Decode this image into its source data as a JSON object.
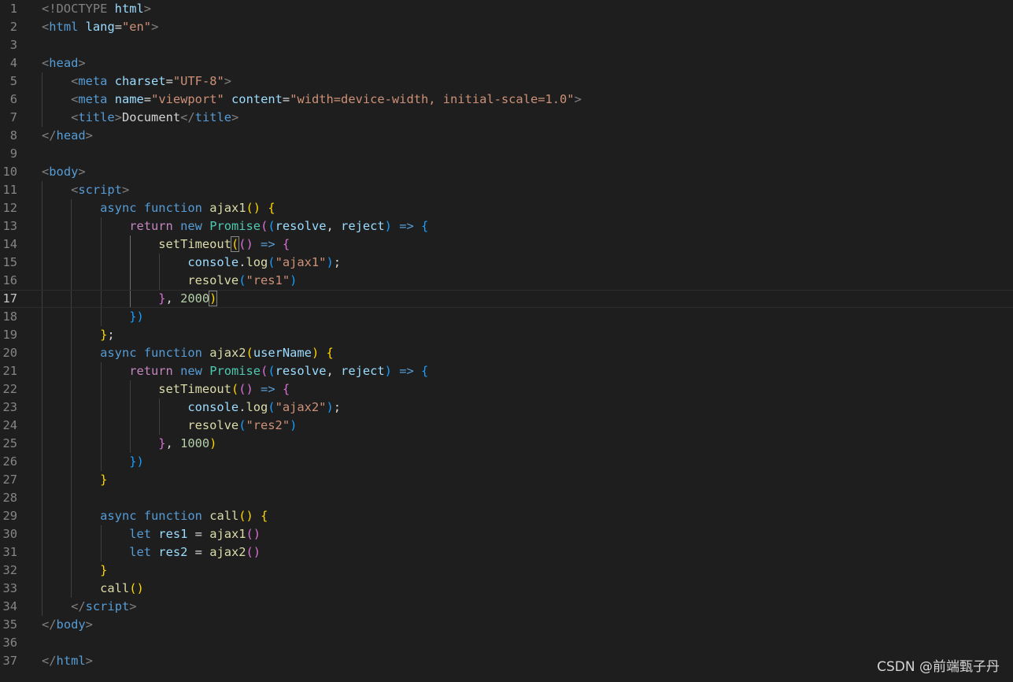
{
  "current_line": 17,
  "lines": [
    {
      "num": "1",
      "tokens": [
        {
          "t": "<!DOCTYPE ",
          "c": "t-br"
        },
        {
          "t": "html",
          "c": "t-attr"
        },
        {
          "t": ">",
          "c": "t-br"
        }
      ]
    },
    {
      "num": "2",
      "tokens": [
        {
          "t": "<",
          "c": "t-br"
        },
        {
          "t": "html",
          "c": "t-tag"
        },
        {
          "t": " ",
          "c": "t-txt"
        },
        {
          "t": "lang",
          "c": "t-attr"
        },
        {
          "t": "=",
          "c": "t-txt"
        },
        {
          "t": "\"en\"",
          "c": "t-str"
        },
        {
          "t": ">",
          "c": "t-br"
        }
      ]
    },
    {
      "num": "3",
      "tokens": []
    },
    {
      "num": "4",
      "tokens": [
        {
          "t": "<",
          "c": "t-br"
        },
        {
          "t": "head",
          "c": "t-tag"
        },
        {
          "t": ">",
          "c": "t-br"
        }
      ]
    },
    {
      "num": "5",
      "tokens": [
        {
          "t": "    ",
          "c": "t-txt"
        },
        {
          "t": "<",
          "c": "t-br"
        },
        {
          "t": "meta",
          "c": "t-tag"
        },
        {
          "t": " ",
          "c": "t-txt"
        },
        {
          "t": "charset",
          "c": "t-attr"
        },
        {
          "t": "=",
          "c": "t-txt"
        },
        {
          "t": "\"UTF-8\"",
          "c": "t-str"
        },
        {
          "t": ">",
          "c": "t-br"
        }
      ]
    },
    {
      "num": "6",
      "tokens": [
        {
          "t": "    ",
          "c": "t-txt"
        },
        {
          "t": "<",
          "c": "t-br"
        },
        {
          "t": "meta",
          "c": "t-tag"
        },
        {
          "t": " ",
          "c": "t-txt"
        },
        {
          "t": "name",
          "c": "t-attr"
        },
        {
          "t": "=",
          "c": "t-txt"
        },
        {
          "t": "\"viewport\"",
          "c": "t-str"
        },
        {
          "t": " ",
          "c": "t-txt"
        },
        {
          "t": "content",
          "c": "t-attr"
        },
        {
          "t": "=",
          "c": "t-txt"
        },
        {
          "t": "\"width=device-width, initial-scale=1.0\"",
          "c": "t-str"
        },
        {
          "t": ">",
          "c": "t-br"
        }
      ]
    },
    {
      "num": "7",
      "tokens": [
        {
          "t": "    ",
          "c": "t-txt"
        },
        {
          "t": "<",
          "c": "t-br"
        },
        {
          "t": "title",
          "c": "t-tag"
        },
        {
          "t": ">",
          "c": "t-br"
        },
        {
          "t": "Document",
          "c": "t-txt"
        },
        {
          "t": "</",
          "c": "t-br"
        },
        {
          "t": "title",
          "c": "t-tag"
        },
        {
          "t": ">",
          "c": "t-br"
        }
      ]
    },
    {
      "num": "8",
      "tokens": [
        {
          "t": "</",
          "c": "t-br"
        },
        {
          "t": "head",
          "c": "t-tag"
        },
        {
          "t": ">",
          "c": "t-br"
        }
      ]
    },
    {
      "num": "9",
      "tokens": []
    },
    {
      "num": "10",
      "tokens": [
        {
          "t": "<",
          "c": "t-br"
        },
        {
          "t": "body",
          "c": "t-tag"
        },
        {
          "t": ">",
          "c": "t-br"
        }
      ]
    },
    {
      "num": "11",
      "tokens": [
        {
          "t": "    ",
          "c": "t-txt"
        },
        {
          "t": "<",
          "c": "t-br"
        },
        {
          "t": "script",
          "c": "t-tag"
        },
        {
          "t": ">",
          "c": "t-br"
        }
      ]
    },
    {
      "num": "12",
      "tokens": [
        {
          "t": "        ",
          "c": "t-txt"
        },
        {
          "t": "async",
          "c": "t-kw"
        },
        {
          "t": " ",
          "c": "t-txt"
        },
        {
          "t": "function",
          "c": "t-kw"
        },
        {
          "t": " ",
          "c": "t-txt"
        },
        {
          "t": "ajax1",
          "c": "t-fn"
        },
        {
          "t": "()",
          "c": "b1"
        },
        {
          "t": " ",
          "c": "t-txt"
        },
        {
          "t": "{",
          "c": "b1"
        }
      ]
    },
    {
      "num": "13",
      "tokens": [
        {
          "t": "            ",
          "c": "t-txt"
        },
        {
          "t": "return",
          "c": "t-ctl"
        },
        {
          "t": " ",
          "c": "t-txt"
        },
        {
          "t": "new",
          "c": "t-kw"
        },
        {
          "t": " ",
          "c": "t-txt"
        },
        {
          "t": "Promise",
          "c": "t-cls"
        },
        {
          "t": "(",
          "c": "b2"
        },
        {
          "t": "(",
          "c": "b3"
        },
        {
          "t": "resolve",
          "c": "t-var"
        },
        {
          "t": ", ",
          "c": "t-txt"
        },
        {
          "t": "reject",
          "c": "t-var"
        },
        {
          "t": ")",
          "c": "b3"
        },
        {
          "t": " ",
          "c": "t-txt"
        },
        {
          "t": "=>",
          "c": "t-kw"
        },
        {
          "t": " ",
          "c": "t-txt"
        },
        {
          "t": "{",
          "c": "b3"
        }
      ]
    },
    {
      "num": "14",
      "tokens": [
        {
          "t": "                ",
          "c": "t-txt"
        },
        {
          "t": "setTimeout",
          "c": "t-fn"
        },
        {
          "t": "(",
          "c": "b1 cursor-box"
        },
        {
          "t": "()",
          "c": "b2"
        },
        {
          "t": " ",
          "c": "t-txt"
        },
        {
          "t": "=>",
          "c": "t-kw"
        },
        {
          "t": " ",
          "c": "t-txt"
        },
        {
          "t": "{",
          "c": "b2"
        }
      ]
    },
    {
      "num": "15",
      "tokens": [
        {
          "t": "                    ",
          "c": "t-txt"
        },
        {
          "t": "console",
          "c": "t-var"
        },
        {
          "t": ".",
          "c": "t-txt"
        },
        {
          "t": "log",
          "c": "t-fn"
        },
        {
          "t": "(",
          "c": "b3"
        },
        {
          "t": "\"ajax1\"",
          "c": "t-str"
        },
        {
          "t": ")",
          "c": "b3"
        },
        {
          "t": ";",
          "c": "t-txt"
        }
      ]
    },
    {
      "num": "16",
      "tokens": [
        {
          "t": "                    ",
          "c": "t-txt"
        },
        {
          "t": "resolve",
          "c": "t-fn"
        },
        {
          "t": "(",
          "c": "b3"
        },
        {
          "t": "\"res1\"",
          "c": "t-str"
        },
        {
          "t": ")",
          "c": "b3"
        }
      ]
    },
    {
      "num": "17",
      "tokens": [
        {
          "t": "                ",
          "c": "t-txt"
        },
        {
          "t": "}",
          "c": "b2"
        },
        {
          "t": ", ",
          "c": "t-txt"
        },
        {
          "t": "2000",
          "c": "t-num"
        },
        {
          "t": ")",
          "c": "b1 cursor-box"
        }
      ]
    },
    {
      "num": "18",
      "tokens": [
        {
          "t": "            ",
          "c": "t-txt"
        },
        {
          "t": "})",
          "c": "b3"
        }
      ]
    },
    {
      "num": "19",
      "tokens": [
        {
          "t": "        ",
          "c": "t-txt"
        },
        {
          "t": "}",
          "c": "b1"
        },
        {
          "t": ";",
          "c": "t-txt"
        }
      ]
    },
    {
      "num": "20",
      "tokens": [
        {
          "t": "        ",
          "c": "t-txt"
        },
        {
          "t": "async",
          "c": "t-kw"
        },
        {
          "t": " ",
          "c": "t-txt"
        },
        {
          "t": "function",
          "c": "t-kw"
        },
        {
          "t": " ",
          "c": "t-txt"
        },
        {
          "t": "ajax2",
          "c": "t-fn"
        },
        {
          "t": "(",
          "c": "b1"
        },
        {
          "t": "userName",
          "c": "t-var"
        },
        {
          "t": ")",
          "c": "b1"
        },
        {
          "t": " ",
          "c": "t-txt"
        },
        {
          "t": "{",
          "c": "b1"
        }
      ]
    },
    {
      "num": "21",
      "tokens": [
        {
          "t": "            ",
          "c": "t-txt"
        },
        {
          "t": "return",
          "c": "t-ctl"
        },
        {
          "t": " ",
          "c": "t-txt"
        },
        {
          "t": "new",
          "c": "t-kw"
        },
        {
          "t": " ",
          "c": "t-txt"
        },
        {
          "t": "Promise",
          "c": "t-cls"
        },
        {
          "t": "(",
          "c": "b2"
        },
        {
          "t": "(",
          "c": "b3"
        },
        {
          "t": "resolve",
          "c": "t-var"
        },
        {
          "t": ", ",
          "c": "t-txt"
        },
        {
          "t": "reject",
          "c": "t-var"
        },
        {
          "t": ")",
          "c": "b3"
        },
        {
          "t": " ",
          "c": "t-txt"
        },
        {
          "t": "=>",
          "c": "t-kw"
        },
        {
          "t": " ",
          "c": "t-txt"
        },
        {
          "t": "{",
          "c": "b3"
        }
      ]
    },
    {
      "num": "22",
      "tokens": [
        {
          "t": "                ",
          "c": "t-txt"
        },
        {
          "t": "setTimeout",
          "c": "t-fn"
        },
        {
          "t": "(",
          "c": "b1"
        },
        {
          "t": "()",
          "c": "b2"
        },
        {
          "t": " ",
          "c": "t-txt"
        },
        {
          "t": "=>",
          "c": "t-kw"
        },
        {
          "t": " ",
          "c": "t-txt"
        },
        {
          "t": "{",
          "c": "b2"
        }
      ]
    },
    {
      "num": "23",
      "tokens": [
        {
          "t": "                    ",
          "c": "t-txt"
        },
        {
          "t": "console",
          "c": "t-var"
        },
        {
          "t": ".",
          "c": "t-txt"
        },
        {
          "t": "log",
          "c": "t-fn"
        },
        {
          "t": "(",
          "c": "b3"
        },
        {
          "t": "\"ajax2\"",
          "c": "t-str"
        },
        {
          "t": ")",
          "c": "b3"
        },
        {
          "t": ";",
          "c": "t-txt"
        }
      ]
    },
    {
      "num": "24",
      "tokens": [
        {
          "t": "                    ",
          "c": "t-txt"
        },
        {
          "t": "resolve",
          "c": "t-fn"
        },
        {
          "t": "(",
          "c": "b3"
        },
        {
          "t": "\"res2\"",
          "c": "t-str"
        },
        {
          "t": ")",
          "c": "b3"
        }
      ]
    },
    {
      "num": "25",
      "tokens": [
        {
          "t": "                ",
          "c": "t-txt"
        },
        {
          "t": "}",
          "c": "b2"
        },
        {
          "t": ", ",
          "c": "t-txt"
        },
        {
          "t": "1000",
          "c": "t-num"
        },
        {
          "t": ")",
          "c": "b1"
        }
      ]
    },
    {
      "num": "26",
      "tokens": [
        {
          "t": "            ",
          "c": "t-txt"
        },
        {
          "t": "})",
          "c": "b3"
        }
      ]
    },
    {
      "num": "27",
      "tokens": [
        {
          "t": "        ",
          "c": "t-txt"
        },
        {
          "t": "}",
          "c": "b1"
        }
      ]
    },
    {
      "num": "28",
      "tokens": []
    },
    {
      "num": "29",
      "tokens": [
        {
          "t": "        ",
          "c": "t-txt"
        },
        {
          "t": "async",
          "c": "t-kw"
        },
        {
          "t": " ",
          "c": "t-txt"
        },
        {
          "t": "function",
          "c": "t-kw"
        },
        {
          "t": " ",
          "c": "t-txt"
        },
        {
          "t": "call",
          "c": "t-fn"
        },
        {
          "t": "()",
          "c": "b1"
        },
        {
          "t": " ",
          "c": "t-txt"
        },
        {
          "t": "{",
          "c": "b1"
        }
      ]
    },
    {
      "num": "30",
      "tokens": [
        {
          "t": "            ",
          "c": "t-txt"
        },
        {
          "t": "let",
          "c": "t-kw"
        },
        {
          "t": " ",
          "c": "t-txt"
        },
        {
          "t": "res1",
          "c": "t-var"
        },
        {
          "t": " = ",
          "c": "t-txt"
        },
        {
          "t": "ajax1",
          "c": "t-fn"
        },
        {
          "t": "()",
          "c": "b2"
        }
      ]
    },
    {
      "num": "31",
      "tokens": [
        {
          "t": "            ",
          "c": "t-txt"
        },
        {
          "t": "let",
          "c": "t-kw"
        },
        {
          "t": " ",
          "c": "t-txt"
        },
        {
          "t": "res2",
          "c": "t-var"
        },
        {
          "t": " = ",
          "c": "t-txt"
        },
        {
          "t": "ajax2",
          "c": "t-fn"
        },
        {
          "t": "()",
          "c": "b2"
        }
      ]
    },
    {
      "num": "32",
      "tokens": [
        {
          "t": "        ",
          "c": "t-txt"
        },
        {
          "t": "}",
          "c": "b1"
        }
      ]
    },
    {
      "num": "33",
      "tokens": [
        {
          "t": "        ",
          "c": "t-txt"
        },
        {
          "t": "call",
          "c": "t-fn"
        },
        {
          "t": "()",
          "c": "b1"
        }
      ]
    },
    {
      "num": "34",
      "tokens": [
        {
          "t": "    ",
          "c": "t-txt"
        },
        {
          "t": "</",
          "c": "t-br"
        },
        {
          "t": "script",
          "c": "t-tag"
        },
        {
          "t": ">",
          "c": "t-br"
        }
      ]
    },
    {
      "num": "35",
      "tokens": [
        {
          "t": "</",
          "c": "t-br"
        },
        {
          "t": "body",
          "c": "t-tag"
        },
        {
          "t": ">",
          "c": "t-br"
        }
      ]
    },
    {
      "num": "36",
      "tokens": []
    },
    {
      "num": "37",
      "tokens": [
        {
          "t": "</",
          "c": "t-br"
        },
        {
          "t": "html",
          "c": "t-tag"
        },
        {
          "t": ">",
          "c": "t-br"
        }
      ]
    }
  ],
  "watermark": "CSDN @前端甄子丹"
}
